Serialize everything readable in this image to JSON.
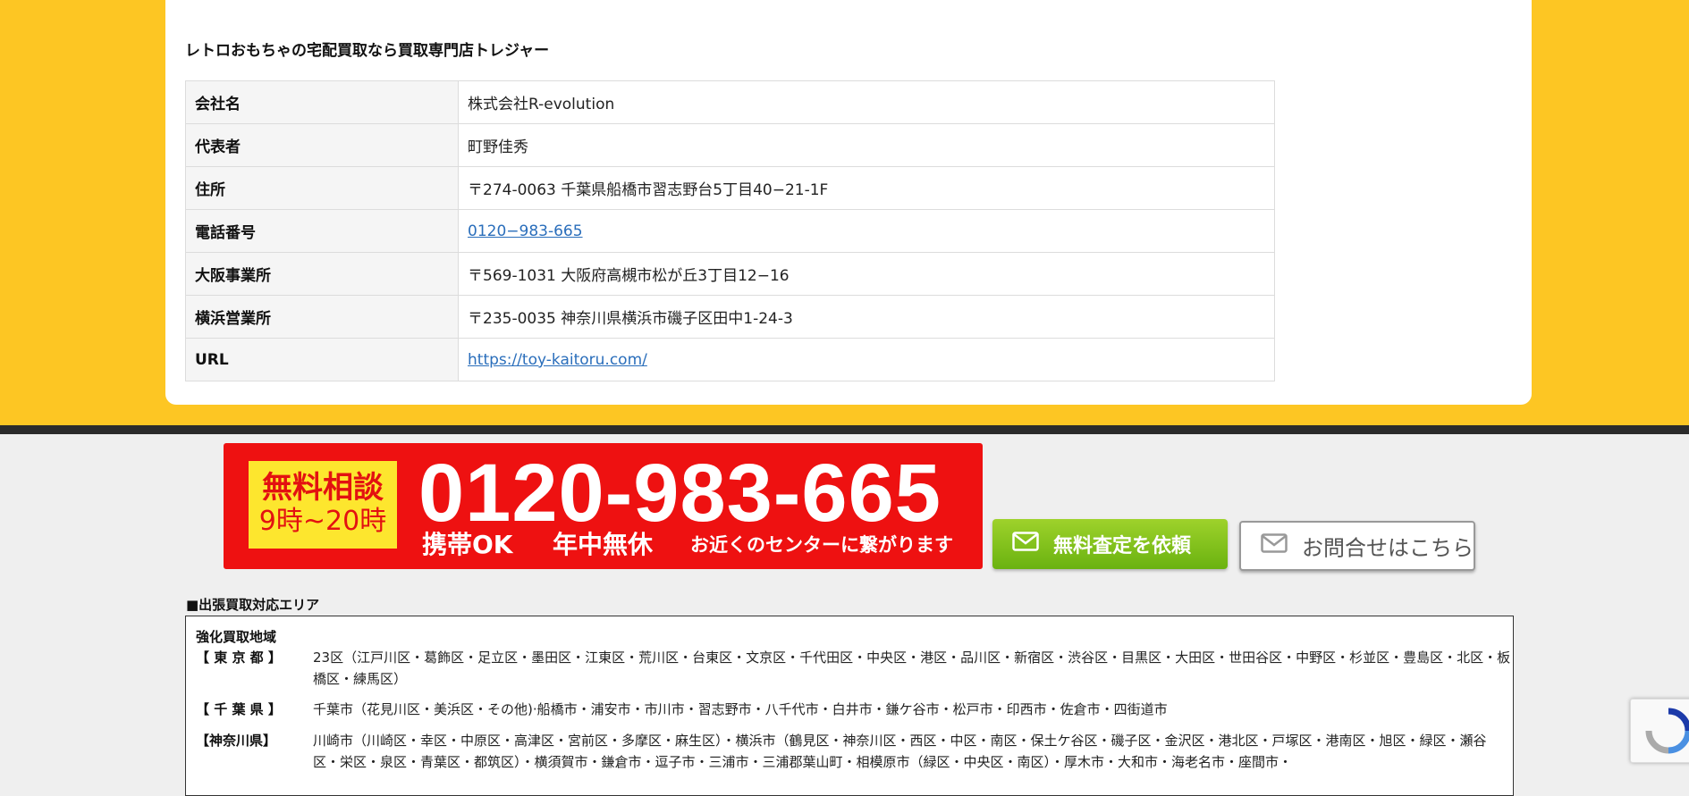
{
  "company_card": {
    "title": "レトロおもちゃの宅配買取なら買取専門店トレジャー",
    "rows": [
      {
        "label": "会社名",
        "value": "株式会社R-evolution"
      },
      {
        "label": "代表者",
        "value": "町野佳秀"
      },
      {
        "label": "住所",
        "value": "〒274-0063 千葉県船橋市習志野台5丁目40−21-1F"
      },
      {
        "label": "電話番号",
        "value": "0120−983-665"
      },
      {
        "label": "大阪事業所",
        "value": "〒569-1031 大阪府高槻市松が丘3丁目12−16"
      },
      {
        "label": "横浜営業所",
        "value": "〒235-0035 神奈川県横浜市磯子区田中1-24-3"
      },
      {
        "label": "URL",
        "value": "https://toy-kaitoru.com/"
      }
    ]
  },
  "phone_banner": {
    "free_label": "無料相談",
    "hours": "9時~20時",
    "number": "0120-983-665",
    "tag_mobile": "携帯OK",
    "tag_open": "年中無休",
    "tag_connect": "お近くのセンターに繋がります"
  },
  "buttons": {
    "estimate": "無料査定を依頼",
    "contact": "お問合せはこちら"
  },
  "service_area": {
    "heading": "■出張買取対応エリア",
    "title": "強化買取地域",
    "rows": [
      {
        "pref": "【 東 京 都 】",
        "cities": "23区（江戸川区・葛飾区・足立区・墨田区・江東区・荒川区・台東区・文京区・千代田区・中央区・港区・品川区・新宿区・渋谷区・目黒区・大田区・世田谷区・中野区・杉並区・豊島区・北区・板橋区・練馬区）"
      },
      {
        "pref": "【 千 葉 県 】",
        "cities": "千葉市（花見川区・美浜区・その他)·船橋市・浦安市・市川市・習志野市・八千代市・白井市・鎌ケ谷市・松戸市・印西市・佐倉市・四街道市"
      },
      {
        "pref": "【神奈川県】",
        "cities": "川崎市（川崎区・幸区・中原区・高津区・宮前区・多摩区・麻生区）・横浜市（鶴見区・神奈川区・西区・中区・南区・保土ケ谷区・磯子区・金沢区・港北区・戸塚区・港南区・旭区・緑区・瀬谷区・栄区・泉区・青葉区・都筑区）・横須賀市・鎌倉市・逗子市・三浦市・三浦郡葉山町・相模原市（緑区・中央区・南区）・厚木市・大和市・海老名市・座間市・"
      }
    ]
  },
  "colors": {
    "band_yellow": "#fdc623",
    "banner_red": "#ee1111",
    "link_blue": "#2a6ebb",
    "button_green": "#7cc11a"
  }
}
